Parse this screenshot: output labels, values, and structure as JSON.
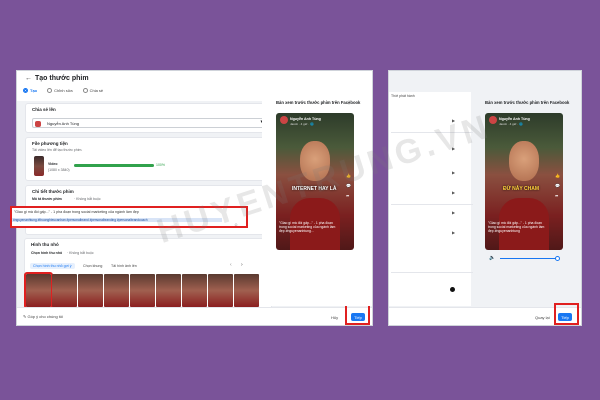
{
  "watermark": "HUYENTRUNG.VN",
  "left": {
    "back_icon": "arrow-left-icon",
    "title": "Tạo thước phim",
    "steps": [
      "Tạo",
      "Chỉnh sửa",
      "Chia sẻ"
    ],
    "share_to_label": "Chia sẻ lên",
    "account_name": "Nguyễn Anh Tùng",
    "media_label": "File phương tiện",
    "media_sub": "Tải video lên để tạo thước phim.",
    "video_title": "Video",
    "video_dims": "(1080 x 3840)",
    "progress_pct": 100,
    "progress_text": "100%",
    "details_label": "Chi tiết thước phim",
    "desc_label": "Mô tả thước phim",
    "desc_optional": "· Không bắt buộc",
    "desc_text": "\"Giao gì mà đòi gấp...\" - 1 pha đoạn trong social marketing của ngành làm đẹp",
    "hashtags": "#nguyenanhtung #thuonghieucanhan #personalbrand #personalbranding #personalbrandcoach",
    "thumb_label": "Hình thu nhỏ",
    "thumb_sub_label": "Chọn hình thu nhỏ",
    "thumb_sub_optional": "· Không bắt buộc",
    "thumb_tabs": [
      "Chọn hình thu nhỏ gợi ý",
      "Chọn khung",
      "Tải hình ảnh lên"
    ],
    "feedback": "Góp ý cho chúng tôi",
    "btn_secondary": "Hủy",
    "btn_next": "Tiếp",
    "preview_head": "Bản xem trước thước phim trên Facebook",
    "preview_user": "Nguyễn Anh Tùng",
    "preview_meta": "Jacob · 4 giờ · 🌐",
    "preview_overlay": "INTERNET HAY LÀ",
    "preview_caption": "\"Giao gì mà đòi gấp...\" - 1 pha đoạn trong social marketing của ngành làm đẹp #nguyenanhtung..."
  },
  "right": {
    "publish_label": "Thời phát hành",
    "preview_head": "Bản xem trước thước phim trên Facebook",
    "preview_user": "Nguyễn Anh Tùng",
    "preview_meta": "Jacob · 4 giờ · 🌐",
    "preview_overlay": "ĐỪ NẪY CHAM",
    "preview_caption": "\"Giao gì mà đòi gấp...\" - 1 pha đoạn trong social marketing của ngành làm đẹp #nguyenanhtung",
    "btn_back": "Quay lại",
    "btn_next": "Tiếp"
  }
}
